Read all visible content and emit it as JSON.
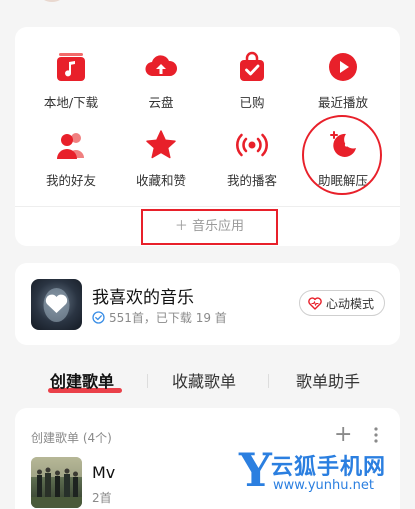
{
  "shortcuts": {
    "items": [
      {
        "label": "本地/下载",
        "icon": "music-note-box-icon"
      },
      {
        "label": "云盘",
        "icon": "cloud-upload-icon"
      },
      {
        "label": "已购",
        "icon": "shopping-bag-check-icon"
      },
      {
        "label": "最近播放",
        "icon": "play-circle-icon"
      },
      {
        "label": "我的好友",
        "icon": "friends-icon"
      },
      {
        "label": "收藏和赞",
        "icon": "star-icon"
      },
      {
        "label": "我的播客",
        "icon": "podcast-icon"
      },
      {
        "label": "助眠解压",
        "icon": "moon-sleep-icon"
      }
    ],
    "add_app_label": "＋ 音乐应用"
  },
  "favorite": {
    "title": "我喜欢的音乐",
    "subtitle": "551首，已下载 19 首",
    "heart_mode_label": "心动模式"
  },
  "tabs": [
    "创建歌单",
    "收藏歌单",
    "歌单助手"
  ],
  "playlists": {
    "header": "创建歌单 (4个)",
    "add_symbol": "+",
    "items": [
      {
        "name": "Mv",
        "count": "2首"
      }
    ]
  },
  "watermark": {
    "letter": "Y",
    "name": "云狐手机网",
    "url": "www.yunhu.net"
  },
  "colors": {
    "brand_red": "#e8202a",
    "watermark_blue": "#2b7fe0",
    "background": "#f5f5f5"
  }
}
